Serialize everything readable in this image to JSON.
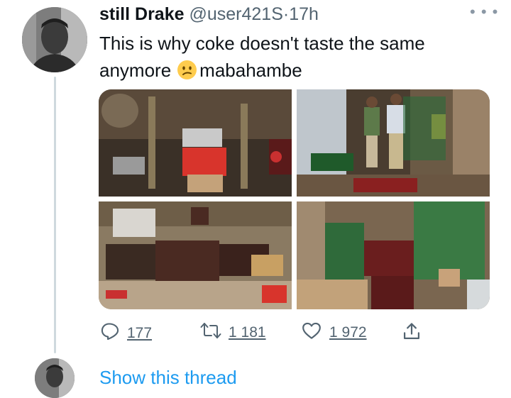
{
  "tweet": {
    "display_name": "still Drake",
    "handle": "@user421S",
    "separator": "·",
    "time": "17h",
    "text_line1": "This is why coke doesn't taste the same",
    "text_line2_before": "anymore",
    "emoji_name": "confused-face",
    "text_line2_after": "mabahambe",
    "more_icon": "more-dots-icon"
  },
  "media": {
    "image_count": 4
  },
  "actions": {
    "replies": "177",
    "retweets": "1 181",
    "likes": "1 972",
    "reply_icon": "reply-bubble-icon",
    "retweet_icon": "retweet-arrows-icon",
    "like_icon": "heart-icon",
    "share_icon": "share-upload-icon"
  },
  "footer": {
    "show_thread": "Show this thread"
  },
  "colors": {
    "link": "#1d9bf0",
    "muted": "#536471",
    "thread_line": "#cfd9de"
  }
}
